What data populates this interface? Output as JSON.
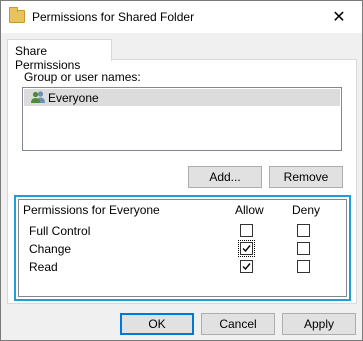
{
  "window": {
    "title": "Permissions for Shared Folder",
    "close_glyph": "✕"
  },
  "tabs": [
    {
      "label": "Share Permissions"
    }
  ],
  "users": {
    "label": "Group or user names:",
    "items": [
      {
        "name": "Everyone",
        "icon": "users-group-icon"
      }
    ]
  },
  "user_buttons": {
    "add": "Add...",
    "remove": "Remove"
  },
  "permissions": {
    "header": "Permissions for Everyone",
    "allow_header": "Allow",
    "deny_header": "Deny",
    "rows": [
      {
        "label": "Full Control",
        "allow": false,
        "deny": false
      },
      {
        "label": "Change",
        "allow": true,
        "deny": false
      },
      {
        "label": "Read",
        "allow": true,
        "deny": false
      }
    ]
  },
  "dialog_buttons": {
    "ok": "OK",
    "cancel": "Cancel",
    "apply": "Apply"
  },
  "colors": {
    "highlight_frame": "#1f9fd8",
    "selected_row": "#dcdcdc",
    "default_button_border": "#0078d7"
  }
}
